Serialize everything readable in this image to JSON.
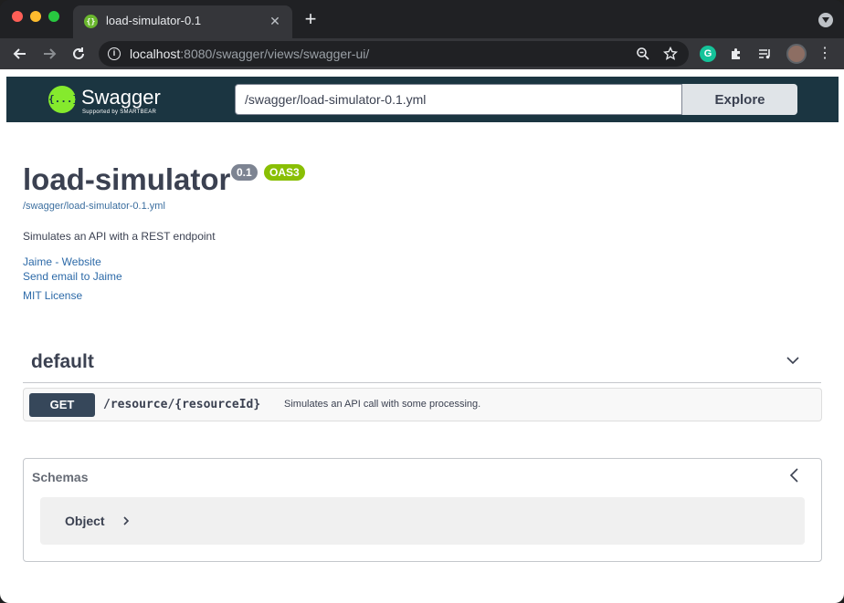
{
  "browser": {
    "tab_title": "load-simulator-0.1",
    "tab_close": "✕",
    "new_tab": "+",
    "url_host": "localhost",
    "url_path": ":8080/swagger/views/swagger-ui/"
  },
  "swagger_topbar": {
    "logo_text": "Swagger",
    "logo_mark": "{...}",
    "logo_sub": "Supported by SMARTBEAR",
    "spec_url_value": "/swagger/load-simulator-0.1.yml",
    "explore_label": "Explore"
  },
  "info": {
    "title": "load-simulator",
    "version": "0.1",
    "oas_badge": "OAS3",
    "spec_link": "/swagger/load-simulator-0.1.yml",
    "description": "Simulates an API with a REST endpoint",
    "contact_website": "Jaime - Website",
    "contact_email": "Send email to Jaime",
    "license": "MIT License"
  },
  "tags": [
    {
      "name": "default",
      "operations": [
        {
          "method": "GET",
          "path": "/resource/{resourceId}",
          "summary": "Simulates an API call with some processing."
        }
      ]
    }
  ],
  "schemas": {
    "title": "Schemas",
    "models": [
      {
        "name": "Object"
      }
    ]
  },
  "colors": {
    "topbar_bg": "#1b3541",
    "swagger_green": "#85ea2d",
    "get_method_bg": "#36475a",
    "oas_badge": "#89bf04",
    "version_badge": "#7d8492"
  }
}
